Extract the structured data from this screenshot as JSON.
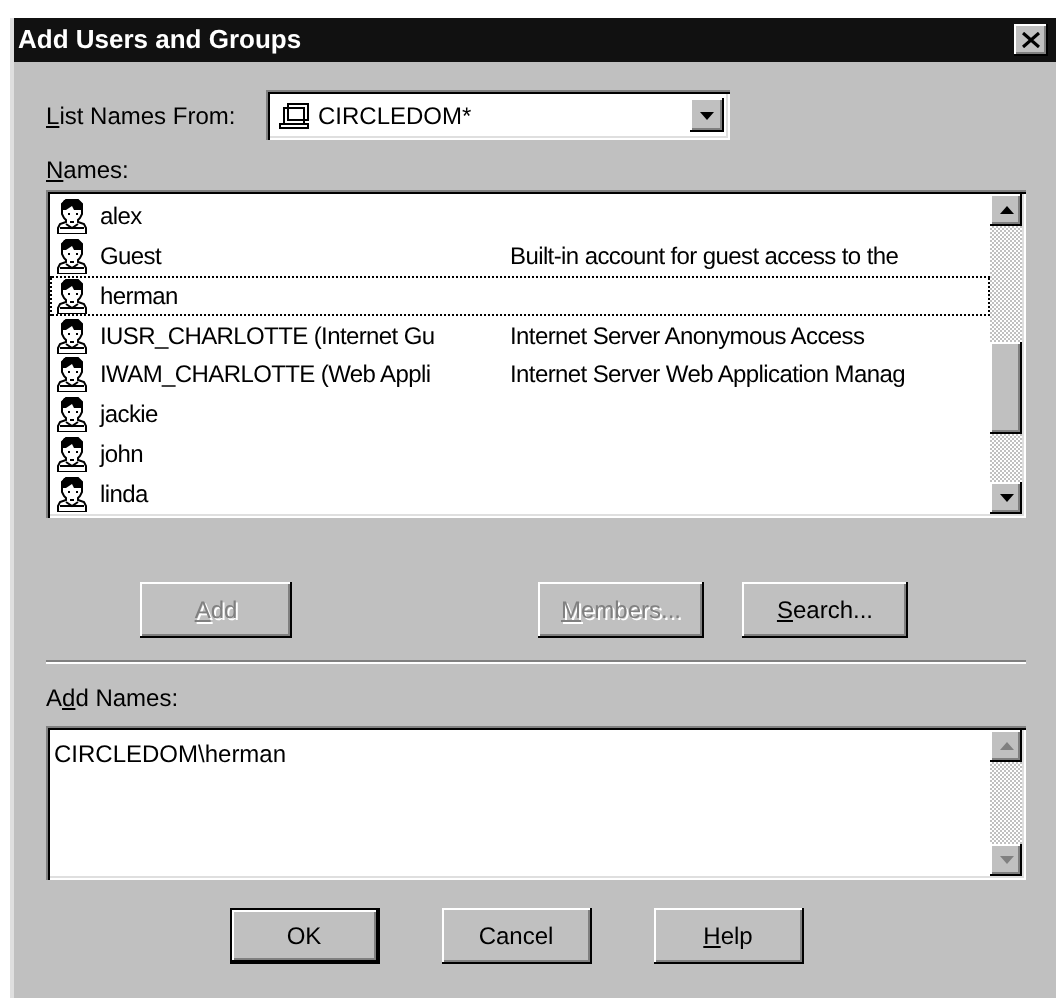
{
  "window": {
    "title": "Add Users and Groups"
  },
  "list_names_from": {
    "label": {
      "key": "L",
      "after": "ist Names From:"
    },
    "value": "CIRCLEDOM*"
  },
  "names": {
    "label": {
      "key": "N",
      "after": "ames:"
    },
    "rows": [
      {
        "name": "alex",
        "focused": false
      },
      {
        "name": "Guest",
        "description": "Built-in account for guest access to the",
        "focused": false
      },
      {
        "name": "herman",
        "focused": true
      },
      {
        "name": "IUSR_CHARLOTTE (Internet Gu",
        "description": "Internet Server Anonymous Access",
        "focused": false
      },
      {
        "name": "IWAM_CHARLOTTE (Web Appli",
        "description": "Internet Server Web Application Manag",
        "focused": false
      },
      {
        "name": "jackie",
        "focused": false
      },
      {
        "name": "john",
        "focused": false
      },
      {
        "name": "linda",
        "focused": false
      }
    ]
  },
  "list_buttons": [
    {
      "label": {
        "key": "A",
        "after": "dd"
      },
      "disabled": true
    },
    {
      "label": {
        "key": "M",
        "after": "embers..."
      },
      "disabled": true
    },
    {
      "label": {
        "key": "S",
        "after": "earch..."
      },
      "disabled": false
    }
  ],
  "add_names": {
    "label": {
      "before": "A",
      "key": "d",
      "after": "d Names:"
    },
    "value": "CIRCLEDOM\\herman"
  },
  "dialog_buttons": [
    {
      "label": {
        "before": "OK"
      },
      "default": true
    },
    {
      "label": {
        "before": "Cancel"
      },
      "default": false
    },
    {
      "label": {
        "key": "H",
        "after": "elp"
      },
      "default": false
    }
  ]
}
